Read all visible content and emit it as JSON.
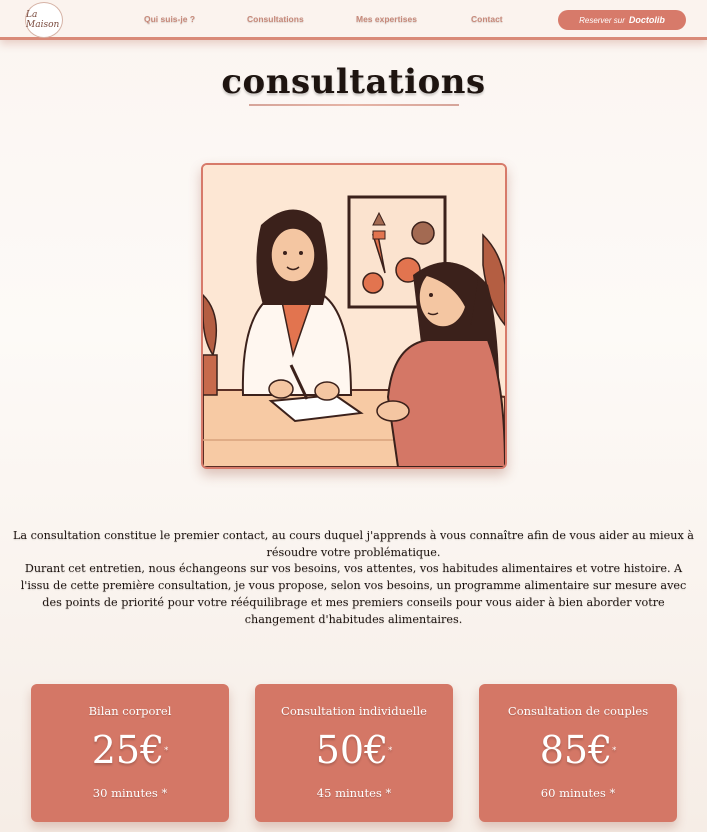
{
  "header": {
    "logo_text": "La Maison",
    "nav": [
      "Qui suis-je ?",
      "Consultations",
      "Mes expertises",
      "Contact"
    ],
    "reserve_label": "Reserver sur",
    "reserve_brand": "Doctolib"
  },
  "main": {
    "title": "consultations",
    "intro_p1": "La consultation constitue le premier contact, au cours duquel j'apprends à vous connaître afin de vous aider au mieux à résoudre votre problématique.",
    "intro_p2": "Durant cet entretien, nous échangeons sur vos besoins, vos attentes, vos habitudes alimentaires et votre histoire. A l'issu de cette première consultation, je vous propose, selon vos besoins, un programme alimentaire sur mesure avec des points de priorité pour votre rééquilibrage et mes premiers conseils pour vous aider à bien aborder votre changement d'habitudes alimentaires."
  },
  "cards": [
    {
      "title": "Bilan corporel",
      "price": "25€",
      "mark": "*",
      "duration": "30 minutes *"
    },
    {
      "title": "Consultation individuelle",
      "price": "50€",
      "mark": "*",
      "duration": "45 minutes *"
    },
    {
      "title": "Consultation de couples",
      "price": "85€",
      "mark": "*",
      "duration": "60 minutes *"
    }
  ],
  "colors": {
    "accent": "#d47766",
    "nav": "#c7897a",
    "illustration_bg": "#fde7d4"
  }
}
